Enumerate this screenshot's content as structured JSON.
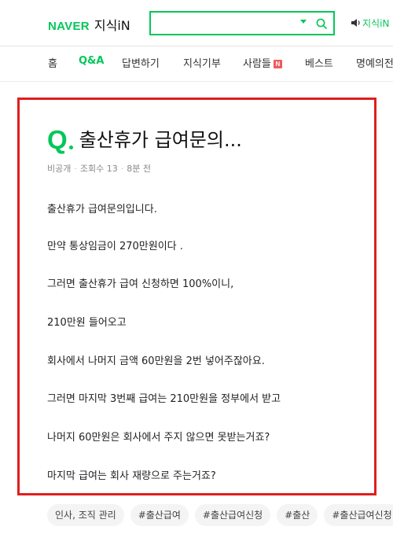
{
  "header": {
    "logo_naver": "NAVER",
    "logo_kin": "지식iN",
    "search_value": "",
    "search_icon": "search-icon",
    "kin_link": "지식iN"
  },
  "nav": {
    "items": [
      {
        "label": "홈",
        "active": false
      },
      {
        "label": "Q&A",
        "active": true
      },
      {
        "label": "답변하기",
        "active": false
      },
      {
        "label": "지식기부",
        "active": false
      },
      {
        "label": "사람들",
        "active": false,
        "badge": "N"
      },
      {
        "label": "베스트",
        "active": false
      },
      {
        "label": "명예의전",
        "active": false
      }
    ]
  },
  "question": {
    "q_mark": "Q",
    "title": "출산휴가 급여문의...",
    "author": "비공개",
    "views": "조회수 13",
    "time": "8분 전",
    "paragraphs": [
      "출산휴가 급여문의입니다.",
      "만약 통상임금이 270만원이다 .",
      "그러면 출산휴가 급여 신청하면 100%이니,",
      "210만원 들어오고",
      "회사에서 나머지 금액 60만원을 2번 넣어주잖아요.",
      "그러면 마지막 3번째 급여는 210만원을 정부에서 받고",
      "나머지 60만원은 회사에서 주지 않으면 못받는거죠?",
      "마지막 급여는 회사 재량으로 주는거죠?"
    ]
  },
  "tags": [
    "인사, 조직 관리",
    "#출산급여",
    "#출산급여신청",
    "#출산",
    "#출산급여신청"
  ],
  "colors": {
    "brand": "#03c75a",
    "highlight_border": "#e01e1e",
    "badge": "#f05a5a"
  }
}
